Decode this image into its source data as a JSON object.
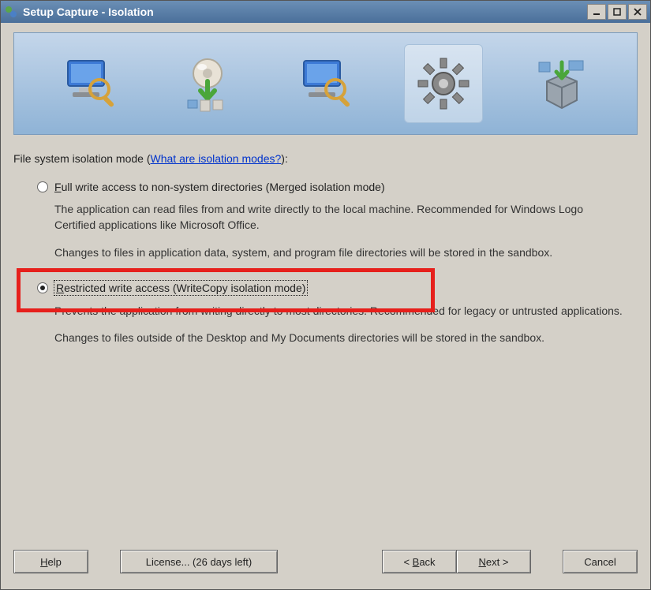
{
  "window": {
    "title": "Setup Capture - Isolation"
  },
  "prompt": {
    "label": "File system isolation mode (",
    "link": "What are isolation modes?",
    "suffix": "):"
  },
  "options": {
    "full": {
      "label": "Full write access to non-system directories (Merged isolation mode)",
      "desc1": "The application can read files from and write directly to the local machine. Recommended for Windows Logo Certified applications like Microsoft Office.",
      "desc2": "Changes to files in application data, system, and program file directories will be stored in the sandbox.",
      "selected": false
    },
    "restricted": {
      "label": "Restricted write access (WriteCopy isolation mode)",
      "desc1": "Prevents the application from writing directly to most directories. Recommended for legacy or untrusted applications.",
      "desc2": "Changes to files outside of the Desktop and My Documents directories will be stored in the sandbox.",
      "selected": true
    }
  },
  "buttons": {
    "help": "Help",
    "license": "License... (26 days left)",
    "back": "< Back",
    "next": "Next >",
    "cancel": "Cancel"
  }
}
